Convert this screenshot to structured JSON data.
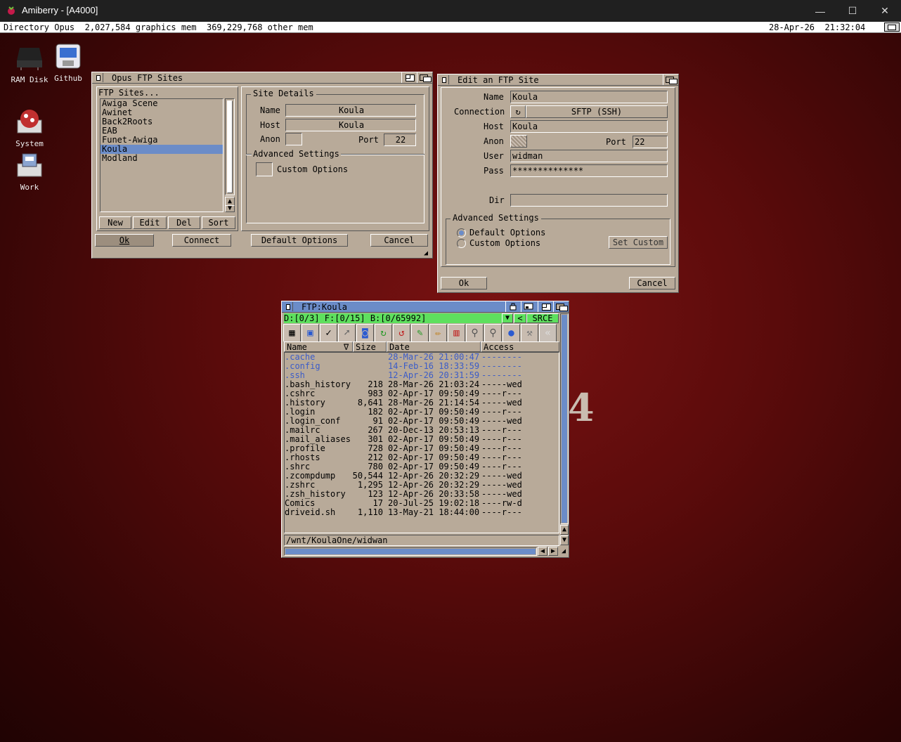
{
  "host": {
    "title": "Amiberry - [A4000]",
    "minimize": "—",
    "maximize": "☐",
    "close": "✕"
  },
  "screen": {
    "left_text": "Directory Opus  2,027,584 graphics mem  369,229,768 other mem",
    "date": "28-Apr-26",
    "time": "21:32:04"
  },
  "desktop_icons": [
    {
      "label": "RAM Disk",
      "icon": "ram-disk-icon"
    },
    {
      "label": "Github",
      "icon": "drawer-icon"
    },
    {
      "label": "System",
      "icon": "system-disk-icon"
    },
    {
      "label": "Work",
      "icon": "work-disk-icon"
    }
  ],
  "ftp_sites_window": {
    "title": "Opus FTP Sites",
    "list_header": "FTP Sites...",
    "sites": [
      "Awiga Scene",
      "Awinet",
      "Back2Roots",
      "EAB",
      "Funet-Awiga",
      "Koula",
      "Modland"
    ],
    "selected_site": "Koula",
    "site_details_label": "Site Details",
    "name_label": "Name",
    "name_value": "Koula",
    "host_label": "Host",
    "host_value": "Koula",
    "anon_label": "Anon",
    "port_label": "Port",
    "port_value": "22",
    "advanced_label": "Advanced Settings",
    "custom_options_label": "Custom Options",
    "list_buttons": [
      "New",
      "Edit",
      "Del",
      "Sort"
    ],
    "ok": "Ok",
    "connect": "Connect",
    "default_options": "Default Options",
    "cancel": "Cancel"
  },
  "edit_site_window": {
    "title": "Edit an FTP Site",
    "name_label": "Name",
    "name_value": "Koula",
    "connection_label": "Connection",
    "connection_value": "SFTP (SSH)",
    "host_label": "Host",
    "host_value": "Koula",
    "anon_label": "Anon",
    "port_label": "Port",
    "port_value": "22",
    "user_label": "User",
    "user_value": "widman",
    "pass_label": "Pass",
    "pass_value": "**************",
    "dir_label": "Dir",
    "dir_value": "",
    "advanced_label": "Advanced Settings",
    "default_options_label": "Default Options",
    "custom_options_label": "Custom Options",
    "set_custom": "Set Custom",
    "ok": "Ok",
    "cancel": "Cancel"
  },
  "lister": {
    "title": "FTP:Koula",
    "status": "D:[0/3] F:[0/15] B:[0/65992]",
    "srce": "SRCE",
    "back_arrow": "<",
    "columns": {
      "name": "Name",
      "sort": "∇",
      "size": "Size",
      "date": "Date",
      "access": "Access"
    },
    "files": [
      {
        "name": ".cache",
        "size": "",
        "date": "28-Mar-26 21:00:47",
        "access": "--------",
        "dir": true
      },
      {
        "name": ".config",
        "size": "",
        "date": "14-Feb-16 18:33:59",
        "access": "--------",
        "dir": true
      },
      {
        "name": ".ssh",
        "size": "",
        "date": "12-Apr-26 20:31:59",
        "access": "--------",
        "dir": true
      },
      {
        "name": ".bash_history",
        "size": "218",
        "date": "28-Mar-26 21:03:24",
        "access": "-----wed",
        "dir": false
      },
      {
        "name": ".cshrc",
        "size": "983",
        "date": "02-Apr-17 09:50:49",
        "access": "----r---",
        "dir": false
      },
      {
        "name": ".history",
        "size": "8,641",
        "date": "28-Mar-26 21:14:54",
        "access": "-----wed",
        "dir": false
      },
      {
        "name": ".login",
        "size": "182",
        "date": "02-Apr-17 09:50:49",
        "access": "----r---",
        "dir": false
      },
      {
        "name": ".login_conf",
        "size": "91",
        "date": "02-Apr-17 09:50:49",
        "access": "-----wed",
        "dir": false
      },
      {
        "name": ".mailrc",
        "size": "267",
        "date": "20-Dec-13 20:53:13",
        "access": "----r---",
        "dir": false
      },
      {
        "name": ".mail_aliases",
        "size": "301",
        "date": "02-Apr-17 09:50:49",
        "access": "----r---",
        "dir": false
      },
      {
        "name": ".profile",
        "size": "728",
        "date": "02-Apr-17 09:50:49",
        "access": "----r---",
        "dir": false
      },
      {
        "name": ".rhosts",
        "size": "212",
        "date": "02-Apr-17 09:50:49",
        "access": "----r---",
        "dir": false
      },
      {
        "name": ".shrc",
        "size": "780",
        "date": "02-Apr-17 09:50:49",
        "access": "----r---",
        "dir": false
      },
      {
        "name": ".zcompdump",
        "size": "50,544",
        "date": "12-Apr-26 20:32:29",
        "access": "-----wed",
        "dir": false
      },
      {
        "name": ".zshrc",
        "size": "1,295",
        "date": "12-Apr-26 20:32:29",
        "access": "-----wed",
        "dir": false
      },
      {
        "name": ".zsh_history",
        "size": "123",
        "date": "12-Apr-26 20:33:58",
        "access": "-----wed",
        "dir": false
      },
      {
        "name": "Comics",
        "size": "17",
        "date": "20-Jul-25 19:02:18",
        "access": "----rw-d",
        "dir": false
      },
      {
        "name": "driveid.sh",
        "size": "1,110",
        "date": "13-May-21 18:44:00",
        "access": "----r---",
        "dir": false
      }
    ],
    "path": "/wnt/KoulaOne/widwan"
  },
  "colors": {
    "amiga_gray": "#b8aa99",
    "select_blue": "#6b8cc8",
    "status_green": "#5ee05e",
    "dir_blue": "#3b5cc8"
  }
}
